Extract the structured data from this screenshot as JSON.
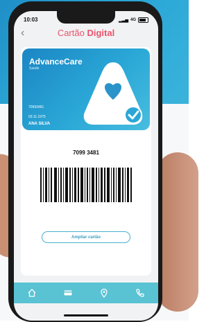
{
  "status": {
    "time": "10:03",
    "network": "4G"
  },
  "header": {
    "title_prefix": "Cartão ",
    "title_bold": "Digital",
    "back_icon": "chevron-left-icon"
  },
  "card": {
    "brand": "AdvanceCare",
    "brand_sub": "Saúde",
    "number": "70993481",
    "date": "03.11.1975",
    "holder": "ANA SILVA"
  },
  "barcode": {
    "number": "7099 3481"
  },
  "actions": {
    "enlarge_label": "Ampliar cartão"
  },
  "tabbar": {
    "items": [
      {
        "icon": "home-icon"
      },
      {
        "icon": "card-icon"
      },
      {
        "icon": "location-pin-icon"
      },
      {
        "icon": "phone-icon"
      }
    ]
  },
  "colors": {
    "accent": "#e9546b",
    "card": "#2aa7d6",
    "tabbar": "#59c2d3",
    "outline": "#4aaecd"
  }
}
